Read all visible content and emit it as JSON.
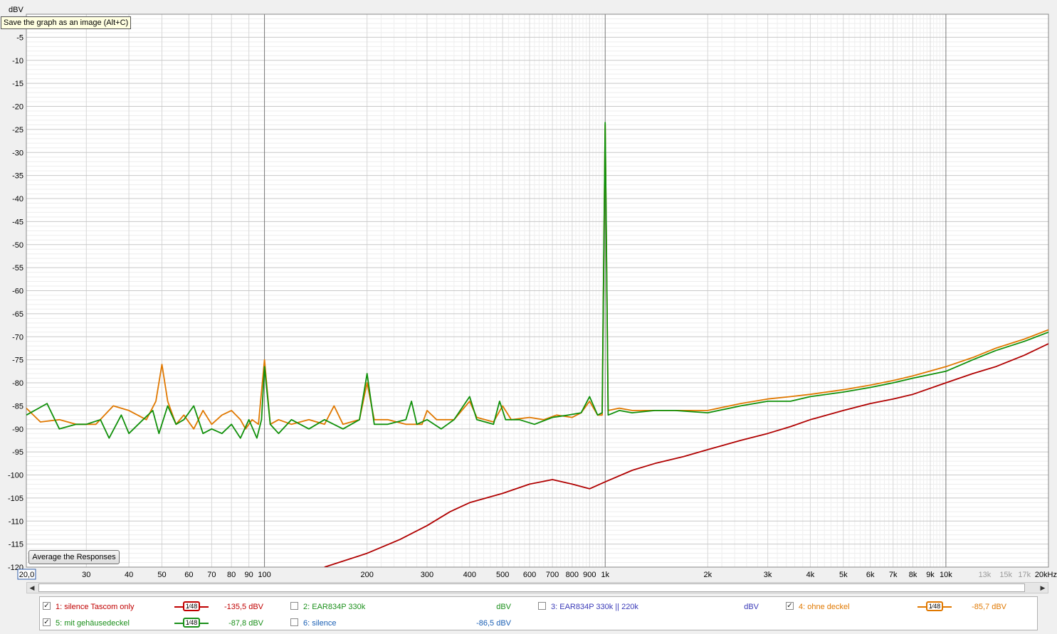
{
  "tooltip": "Save the graph as an image (Alt+C)",
  "average_button": "Average the Responses",
  "chart_data": {
    "type": "line",
    "xscale": "log",
    "xlim": [
      20,
      20000
    ],
    "ylim": [
      -120,
      0
    ],
    "ylabel": "dBV",
    "xunit": "Hz",
    "x_start_label": "20,0",
    "xticks": [
      {
        "f": 30,
        "label": "30"
      },
      {
        "f": 40,
        "label": "40"
      },
      {
        "f": 50,
        "label": "50"
      },
      {
        "f": 60,
        "label": "60"
      },
      {
        "f": 70,
        "label": "70"
      },
      {
        "f": 80,
        "label": "80"
      },
      {
        "f": 90,
        "label": "90"
      },
      {
        "f": 100,
        "label": "100"
      },
      {
        "f": 200,
        "label": "200"
      },
      {
        "f": 300,
        "label": "300"
      },
      {
        "f": 400,
        "label": "400"
      },
      {
        "f": 500,
        "label": "500"
      },
      {
        "f": 600,
        "label": "600"
      },
      {
        "f": 700,
        "label": "700"
      },
      {
        "f": 800,
        "label": "800"
      },
      {
        "f": 900,
        "label": "900"
      },
      {
        "f": 1000,
        "label": "1k"
      },
      {
        "f": 2000,
        "label": "2k"
      },
      {
        "f": 3000,
        "label": "3k"
      },
      {
        "f": 4000,
        "label": "4k"
      },
      {
        "f": 5000,
        "label": "5k"
      },
      {
        "f": 6000,
        "label": "6k"
      },
      {
        "f": 7000,
        "label": "7k"
      },
      {
        "f": 8000,
        "label": "8k"
      },
      {
        "f": 9000,
        "label": "9k"
      },
      {
        "f": 10000,
        "label": "10k"
      },
      {
        "f": 13000,
        "label": "13k",
        "faint": true
      },
      {
        "f": 15000,
        "label": "15k",
        "faint": true
      },
      {
        "f": 17000,
        "label": "17k",
        "faint": true
      },
      {
        "f": 20000,
        "label": "20kHz"
      }
    ],
    "yticks": [
      {
        "v": -5,
        "label": "-5"
      },
      {
        "v": -10,
        "label": "-10"
      },
      {
        "v": -15,
        "label": "-15"
      },
      {
        "v": -20,
        "label": "-20"
      },
      {
        "v": -25,
        "label": "-25"
      },
      {
        "v": -30,
        "label": "-30"
      },
      {
        "v": -35,
        "label": "-35"
      },
      {
        "v": -40,
        "label": "-40"
      },
      {
        "v": -45,
        "label": "-45"
      },
      {
        "v": -50,
        "label": "-50"
      },
      {
        "v": -55,
        "label": "-55"
      },
      {
        "v": -60,
        "label": "-60"
      },
      {
        "v": -65,
        "label": "-65"
      },
      {
        "v": -70,
        "label": "-70"
      },
      {
        "v": -75,
        "label": "-75"
      },
      {
        "v": -80,
        "label": "-80"
      },
      {
        "v": -85,
        "label": "-85"
      },
      {
        "v": -90,
        "label": "-90"
      },
      {
        "v": -95,
        "label": "-95"
      },
      {
        "v": -100,
        "label": "-100"
      },
      {
        "v": -105,
        "label": "-105"
      },
      {
        "v": -110,
        "label": "-110"
      },
      {
        "v": -115,
        "label": "-115"
      },
      {
        "v": -120,
        "label": "-120"
      }
    ],
    "series": [
      {
        "name": "4: ohne deckel",
        "color": "#e07800",
        "points": [
          [
            20,
            -85.5
          ],
          [
            22,
            -88.5
          ],
          [
            25,
            -88
          ],
          [
            28,
            -89
          ],
          [
            32,
            -89
          ],
          [
            36,
            -85
          ],
          [
            40,
            -86
          ],
          [
            45,
            -88
          ],
          [
            48,
            -84
          ],
          [
            50,
            -76
          ],
          [
            52,
            -84
          ],
          [
            55,
            -89
          ],
          [
            58,
            -87
          ],
          [
            62,
            -90
          ],
          [
            66,
            -86
          ],
          [
            70,
            -89
          ],
          [
            75,
            -87
          ],
          [
            80,
            -86
          ],
          [
            85,
            -88
          ],
          [
            88,
            -90
          ],
          [
            92,
            -88
          ],
          [
            96,
            -89
          ],
          [
            100,
            -75
          ],
          [
            104,
            -89
          ],
          [
            110,
            -88
          ],
          [
            120,
            -89
          ],
          [
            135,
            -88
          ],
          [
            150,
            -89
          ],
          [
            160,
            -85
          ],
          [
            170,
            -89
          ],
          [
            190,
            -88
          ],
          [
            200,
            -80
          ],
          [
            210,
            -88
          ],
          [
            230,
            -88
          ],
          [
            260,
            -89
          ],
          [
            290,
            -89
          ],
          [
            300,
            -86
          ],
          [
            320,
            -88
          ],
          [
            360,
            -88
          ],
          [
            400,
            -84
          ],
          [
            420,
            -87.5
          ],
          [
            470,
            -88.5
          ],
          [
            500,
            -85
          ],
          [
            530,
            -88
          ],
          [
            600,
            -87.5
          ],
          [
            660,
            -88
          ],
          [
            720,
            -87
          ],
          [
            800,
            -87.5
          ],
          [
            850,
            -86.5
          ],
          [
            900,
            -84
          ],
          [
            950,
            -87
          ],
          [
            980,
            -87
          ],
          [
            1000,
            -24
          ],
          [
            1020,
            -86
          ],
          [
            1100,
            -85.5
          ],
          [
            1200,
            -86
          ],
          [
            1400,
            -86
          ],
          [
            1600,
            -86
          ],
          [
            2000,
            -86
          ],
          [
            2500,
            -84.5
          ],
          [
            3000,
            -83.5
          ],
          [
            3500,
            -83
          ],
          [
            4000,
            -82.5
          ],
          [
            5000,
            -81.5
          ],
          [
            6000,
            -80.5
          ],
          [
            7000,
            -79.5
          ],
          [
            8000,
            -78.5
          ],
          [
            10000,
            -76.5
          ],
          [
            12000,
            -74.5
          ],
          [
            14000,
            -72.5
          ],
          [
            17000,
            -70.5
          ],
          [
            20000,
            -68.5
          ]
        ]
      },
      {
        "name": "5: mit gehäusedeckel",
        "color": "#10900a",
        "points": [
          [
            20,
            -87
          ],
          [
            23,
            -84.5
          ],
          [
            25,
            -90
          ],
          [
            28,
            -89
          ],
          [
            30,
            -89
          ],
          [
            33,
            -88
          ],
          [
            35,
            -92
          ],
          [
            38,
            -87
          ],
          [
            40,
            -91
          ],
          [
            44,
            -88
          ],
          [
            47,
            -86
          ],
          [
            49,
            -91
          ],
          [
            52,
            -85
          ],
          [
            55,
            -89
          ],
          [
            58,
            -88
          ],
          [
            62,
            -85
          ],
          [
            66,
            -91
          ],
          [
            70,
            -90
          ],
          [
            75,
            -91
          ],
          [
            80,
            -89
          ],
          [
            85,
            -92
          ],
          [
            90,
            -88
          ],
          [
            95,
            -92
          ],
          [
            98,
            -88
          ],
          [
            100,
            -76.5
          ],
          [
            104,
            -89
          ],
          [
            110,
            -91
          ],
          [
            120,
            -88
          ],
          [
            135,
            -90
          ],
          [
            150,
            -88
          ],
          [
            170,
            -90
          ],
          [
            190,
            -88
          ],
          [
            200,
            -78
          ],
          [
            210,
            -89
          ],
          [
            230,
            -89
          ],
          [
            260,
            -88
          ],
          [
            270,
            -84
          ],
          [
            280,
            -89
          ],
          [
            300,
            -88
          ],
          [
            330,
            -90
          ],
          [
            360,
            -88
          ],
          [
            400,
            -83
          ],
          [
            420,
            -88
          ],
          [
            470,
            -89
          ],
          [
            490,
            -84
          ],
          [
            510,
            -88
          ],
          [
            560,
            -88
          ],
          [
            620,
            -89
          ],
          [
            700,
            -87.5
          ],
          [
            780,
            -87
          ],
          [
            850,
            -86.5
          ],
          [
            900,
            -83
          ],
          [
            950,
            -87
          ],
          [
            980,
            -86.5
          ],
          [
            1000,
            -23.5
          ],
          [
            1020,
            -87
          ],
          [
            1100,
            -86
          ],
          [
            1200,
            -86.5
          ],
          [
            1400,
            -86
          ],
          [
            1600,
            -86
          ],
          [
            2000,
            -86.5
          ],
          [
            2500,
            -85
          ],
          [
            3000,
            -84
          ],
          [
            3500,
            -84
          ],
          [
            4000,
            -83
          ],
          [
            5000,
            -82
          ],
          [
            6000,
            -81
          ],
          [
            7000,
            -80
          ],
          [
            8000,
            -79
          ],
          [
            10000,
            -77.5
          ],
          [
            12000,
            -75
          ],
          [
            14000,
            -73
          ],
          [
            17000,
            -71
          ],
          [
            20000,
            -69
          ]
        ]
      },
      {
        "name": "1: silence Tascom only",
        "color": "#b00000",
        "points": [
          [
            150,
            -120
          ],
          [
            200,
            -117
          ],
          [
            250,
            -114
          ],
          [
            300,
            -111
          ],
          [
            350,
            -108
          ],
          [
            400,
            -106
          ],
          [
            500,
            -104
          ],
          [
            600,
            -102
          ],
          [
            700,
            -101
          ],
          [
            800,
            -102
          ],
          [
            900,
            -103
          ],
          [
            1000,
            -101.5
          ],
          [
            1200,
            -99
          ],
          [
            1400,
            -97.5
          ],
          [
            1700,
            -96
          ],
          [
            2000,
            -94.5
          ],
          [
            2500,
            -92.5
          ],
          [
            3000,
            -91
          ],
          [
            3500,
            -89.5
          ],
          [
            4000,
            -88
          ],
          [
            5000,
            -86
          ],
          [
            6000,
            -84.5
          ],
          [
            7000,
            -83.5
          ],
          [
            8000,
            -82.5
          ],
          [
            10000,
            -80
          ],
          [
            12000,
            -78
          ],
          [
            14000,
            -76.5
          ],
          [
            17000,
            -74
          ],
          [
            20000,
            -71.5
          ]
        ]
      }
    ]
  },
  "legend": {
    "entries": [
      {
        "label": "1: silence Tascom only",
        "checked": true,
        "color": "#c00000",
        "smoothing": "1⁄48",
        "value": "-135,5 dBV"
      },
      {
        "label": "2: EAR834P 330k",
        "checked": false,
        "color": "#1a8f1a",
        "smoothing": "",
        "value": "dBV"
      },
      {
        "label": "3: EAR834P 330k || 220k",
        "checked": false,
        "color": "#3a3ab8",
        "smoothing": "",
        "value": "dBV"
      },
      {
        "label": "4: ohne deckel",
        "checked": true,
        "color": "#e07800",
        "smoothing": "1⁄48",
        "value": "-85,7 dBV"
      },
      {
        "label": "5: mit gehäusedeckel",
        "checked": true,
        "color": "#1a8f1a",
        "smoothing": "1⁄48",
        "value": "-87,8 dBV"
      },
      {
        "label": "6: silence",
        "checked": false,
        "color": "#1a5fb4",
        "smoothing": "",
        "value": "-86,5 dBV"
      }
    ]
  },
  "scrollbar": {
    "left_arrow": "◀",
    "right_arrow": "▶"
  }
}
